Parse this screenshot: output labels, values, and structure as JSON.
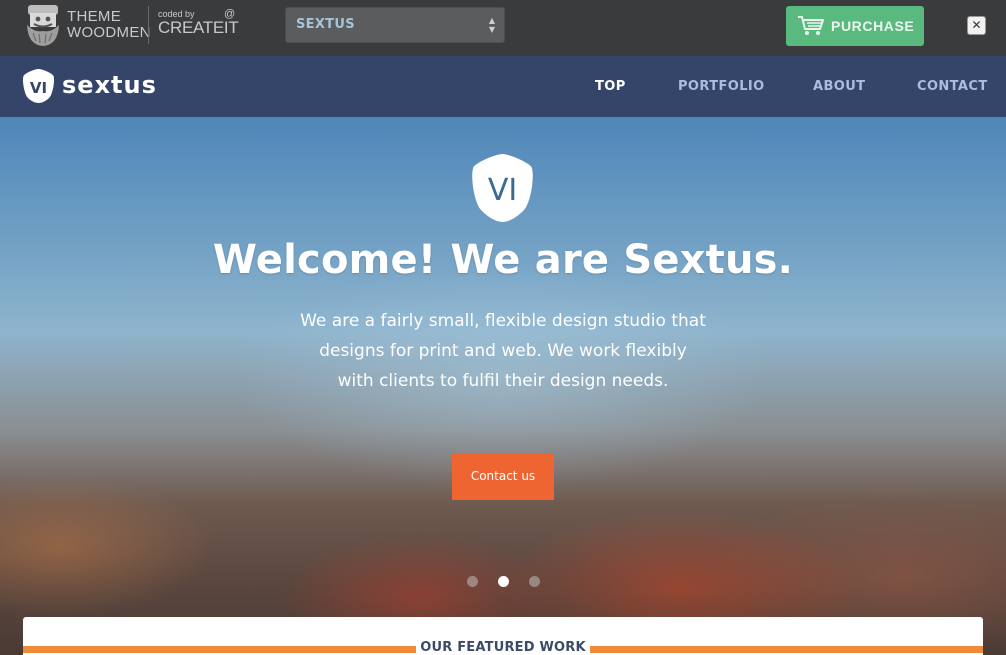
{
  "topbar": {
    "theme_woodmen_line1": "THEME",
    "theme_woodmen_line2": "WOODMEN",
    "coded_by": "coded by",
    "createit": "CREATEIT",
    "createit_at": "@",
    "theme_select": {
      "selected": "SEXTUS"
    },
    "purchase_label": "PURCHASE",
    "close_symbol": "✕"
  },
  "nav": {
    "logo_badge": "VI",
    "logo_name": "sextus",
    "items": [
      {
        "label": "TOP",
        "active": true
      },
      {
        "label": "PORTFOLIO",
        "active": false
      },
      {
        "label": "ABOUT",
        "active": false
      },
      {
        "label": "CONTACT",
        "active": false
      }
    ]
  },
  "hero": {
    "badge": "VI",
    "title": "Welcome! We are Sextus.",
    "text_lines": [
      "We are a fairly small, flexible design studio that",
      "designs for print and web. We work flexibly",
      "with clients to fulfil their design needs."
    ],
    "cta": "Contact us",
    "slides": {
      "count": 3,
      "active": 2
    }
  },
  "featured": {
    "title": "OUR FEATURED WORK"
  },
  "colors": {
    "topbar_bg": "#3a3b3c",
    "nav_bg": "#35456a",
    "accent_orange": "#ef6531",
    "purchase_green": "#5ab97e",
    "nav_link": "#a9bde0"
  },
  "icons": {
    "woodmen_logo": "bearded-face-icon",
    "cart": "shopping-cart-icon",
    "select_arrows": "select-arrows-icon",
    "close": "close-icon",
    "badge": "hexagon-badge-icon"
  }
}
